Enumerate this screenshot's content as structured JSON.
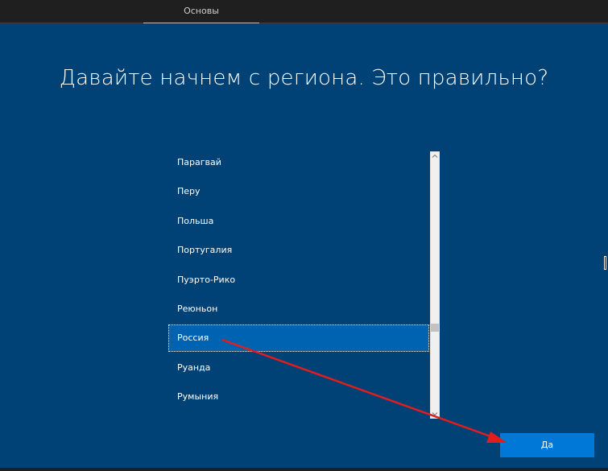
{
  "header": {
    "tab_label": "Основы"
  },
  "main": {
    "title": "Давайте начнем с региона. Это правильно?",
    "regions": [
      {
        "label": "Парагвай",
        "selected": false
      },
      {
        "label": "Перу",
        "selected": false
      },
      {
        "label": "Польша",
        "selected": false
      },
      {
        "label": "Португалия",
        "selected": false
      },
      {
        "label": "Пуэрто-Рико",
        "selected": false
      },
      {
        "label": "Реюньон",
        "selected": false
      },
      {
        "label": "Россия",
        "selected": true
      },
      {
        "label": "Руанда",
        "selected": false
      },
      {
        "label": "Румыния",
        "selected": false
      }
    ],
    "yes_button_label": "Да"
  },
  "icons": {
    "scroll_up": "chevron-up-icon",
    "scroll_down": "chevron-down-icon",
    "annotation": "red-arrow-icon"
  },
  "colors": {
    "background": "#004275",
    "topbar": "#1f1f1f",
    "selected_item": "#0063b1",
    "button": "#0078d7",
    "annotation_arrow": "#e11d1d"
  }
}
